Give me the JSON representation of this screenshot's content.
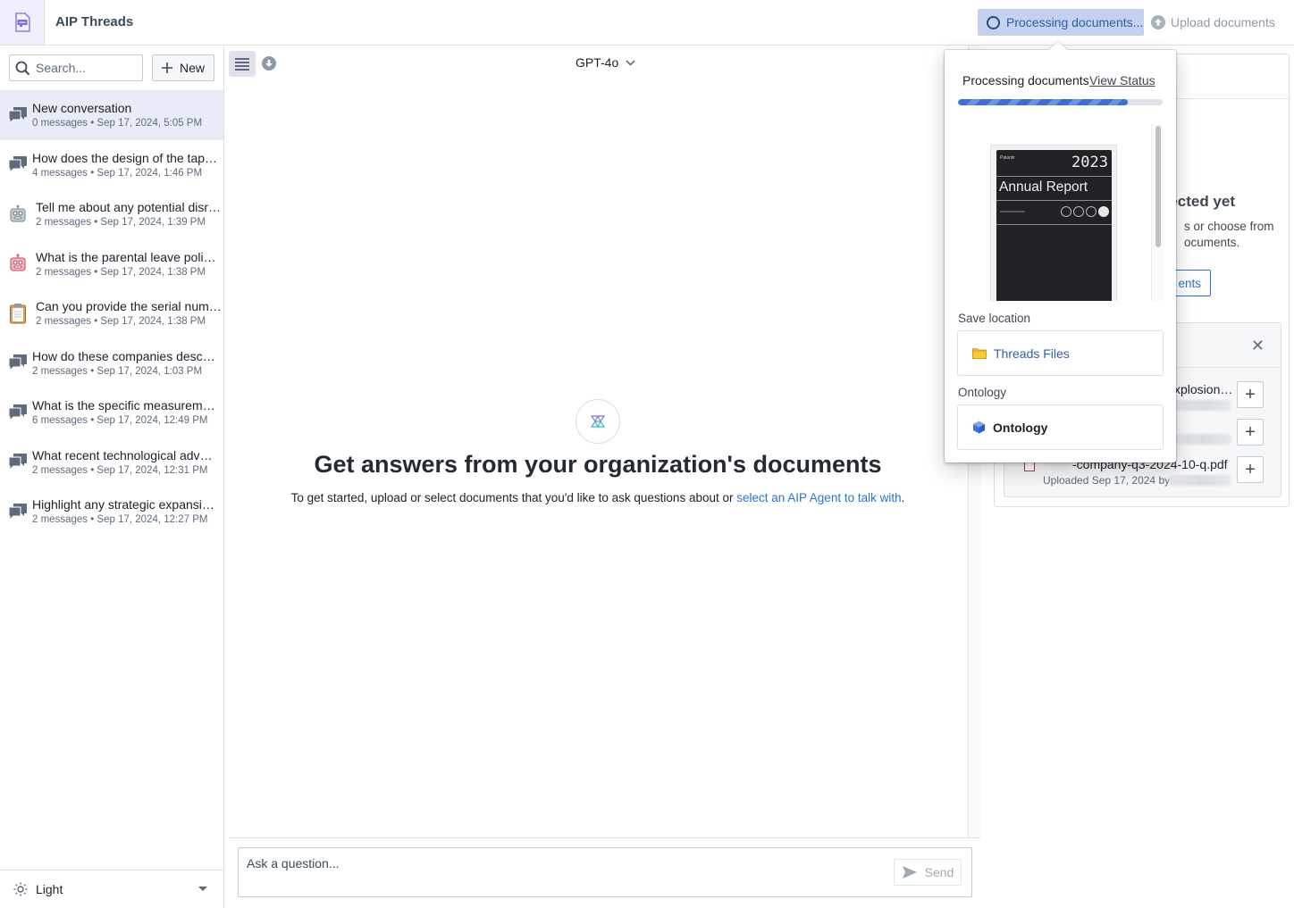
{
  "app": {
    "title": "AIP Threads",
    "icon": "threads-app-icon"
  },
  "header": {
    "processing_label": "Processing documents...",
    "upload_label": "Upload documents"
  },
  "sidebar": {
    "search_placeholder": "Search...",
    "new_label": "New",
    "conversations": [
      {
        "title": "New conversation",
        "meta": "0 messages • Sep 17, 2024, 5:05 PM",
        "icon": "chat-bubbles-icon",
        "active": true
      },
      {
        "title": "How does the design of the taper …",
        "meta": "4 messages • Sep 17, 2024, 1:46 PM",
        "icon": "chat-bubbles-icon"
      },
      {
        "title": "Tell me about any potential disr…",
        "meta": "2 messages • Sep 17, 2024, 1:39 PM",
        "icon": "robot-gray-icon"
      },
      {
        "title": "What is the parental leave policy?",
        "meta": "2 messages • Sep 17, 2024, 1:38 PM",
        "icon": "robot-pink-icon"
      },
      {
        "title": "Can you provide the serial numb…",
        "meta": "2 messages • Sep 17, 2024, 1:38 PM",
        "icon": "clipboard-icon"
      },
      {
        "title": "How do these companies describ…",
        "meta": "2 messages • Sep 17, 2024, 1:03 PM",
        "icon": "chat-bubbles-icon"
      },
      {
        "title": "What is the specific measuremen…",
        "meta": "6 messages • Sep 17, 2024, 12:49 PM",
        "icon": "chat-bubbles-icon"
      },
      {
        "title": "What recent technological advan…",
        "meta": "2 messages • Sep 17, 2024, 12:31 PM",
        "icon": "chat-bubbles-icon"
      },
      {
        "title": "Highlight any strategic expansion…",
        "meta": "2 messages • Sep 17, 2024, 12:27 PM",
        "icon": "chat-bubbles-icon"
      }
    ],
    "theme_label": "Light"
  },
  "main": {
    "model": "GPT-4o",
    "hero_title": "Get answers from your organization's documents",
    "hero_text": "To get started, upload or select documents that you'd like to ask questions about or ",
    "hero_link": "select an AIP Agent to talk with",
    "hero_end": ".",
    "ask_placeholder": "Ask a question...",
    "send_label": "Send"
  },
  "right_panel": {
    "empty_title": "ected yet",
    "empty_text_1": "s or choose from",
    "empty_text_2": "ocuments.",
    "browse_label": "ents",
    "recent_items": [
      {
        "name": "xplosion…",
        "meta": ""
      },
      {
        "name": "",
        "meta": ""
      },
      {
        "name": "-company-q3-2024-10-q.pdf",
        "meta": "Uploaded Sep 17, 2024 by"
      }
    ]
  },
  "popover": {
    "title": "Processing documents",
    "view_status": "View Status",
    "progress_percent": 83,
    "preview": {
      "brand": "Palantir",
      "year": "2023",
      "name": "Annual Report"
    },
    "save_location_label": "Save location",
    "save_location_value": "Threads Files",
    "ontology_label": "Ontology",
    "ontology_value": "Ontology"
  },
  "colors": {
    "accent": "#2d72d2",
    "processing_bg": "#c4d2ef",
    "active_row": "#e8ecf6"
  }
}
